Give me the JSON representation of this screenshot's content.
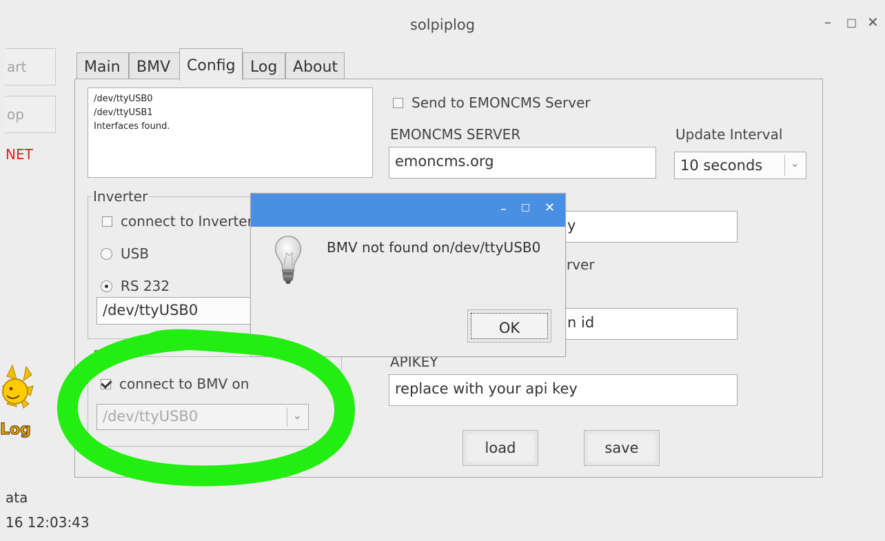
{
  "window": {
    "title": "solpiplog"
  },
  "sidebar": {
    "start_label": "art",
    "stop_label": "op",
    "status": "NET",
    "info_label": "ata",
    "timestamp": "16 12:03:43",
    "logo_text": "Log"
  },
  "tabs": [
    {
      "label": "Main"
    },
    {
      "label": "BMV"
    },
    {
      "label": "Config"
    },
    {
      "label": "Log"
    },
    {
      "label": "About"
    }
  ],
  "config": {
    "log_lines": [
      "/dev/ttyUSB0",
      "/dev/ttyUSB1",
      "Interfaces found."
    ],
    "inverter": {
      "group_title": "Inverter",
      "connect_label": "connect to Inverter",
      "connect_checked": false,
      "usb_label": "USB",
      "rs232_label": "RS 232",
      "selected_interface": "rs232",
      "port_value": "/dev/ttyUSB0"
    },
    "bmv": {
      "group_title": "BMV",
      "connect_label": "connect to BMV on",
      "connect_checked": true,
      "port_value": "/dev/ttyUSB0"
    },
    "emoncms": {
      "send_label": "Send to EMONCMS Server",
      "send_checked": false,
      "server_label": "EMONCMS SERVER",
      "server_value": "emoncms.org",
      "interval_label": "Update Interval",
      "interval_value": "10 seconds",
      "key_field_value": "y",
      "server_label2_partial": "rver",
      "node_field_value": "n id",
      "apikey_label": "APIKEY",
      "apikey_value": "replace with your api key"
    },
    "load_label": "load",
    "save_label": "save"
  },
  "dialog": {
    "message": "BMV not found on/dev/ttyUSB0",
    "ok_label": "OK",
    "titlebar_color": "#4a90e2"
  },
  "colors": {
    "background": "#ededed",
    "status_red": "#e02020",
    "highlight_green": "#22ee11"
  }
}
